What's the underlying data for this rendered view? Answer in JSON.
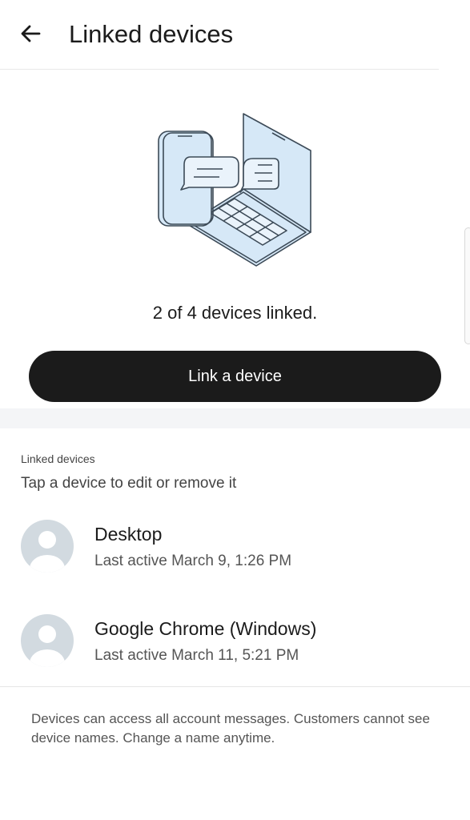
{
  "header": {
    "title": "Linked devices",
    "back_icon": "arrow-left-icon"
  },
  "illustration": {
    "icon": "phone-laptop-chat-illustration",
    "fill_color": "#d6e8f7",
    "stroke_color": "#3c4a57"
  },
  "status": {
    "text": "2 of 4 devices linked."
  },
  "link_button": {
    "label": "Link a device",
    "background": "#1b1b1b"
  },
  "devices_section": {
    "label": "Linked devices",
    "hint": "Tap a device to edit or remove it",
    "devices": [
      {
        "name": "Desktop",
        "last_active": "Last active March 9, 1:26 PM",
        "avatar_icon": "person-avatar-icon"
      },
      {
        "name": "Google Chrome (Windows)",
        "last_active": "Last active March 11, 5:21 PM",
        "avatar_icon": "person-avatar-icon"
      }
    ]
  },
  "footer": {
    "note": "Devices can access all account messages. Customers cannot see device names. Change a name anytime."
  }
}
